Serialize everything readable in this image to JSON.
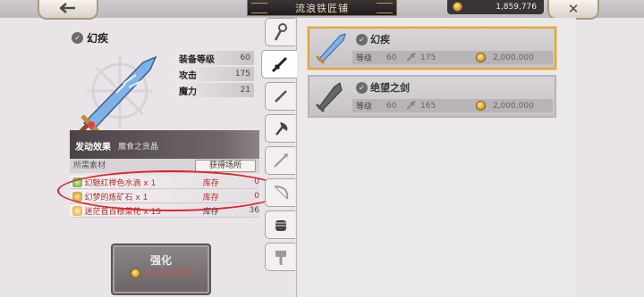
{
  "header": {
    "back_icon": "arrow-left-icon",
    "back_glyph": "🡐",
    "title": "流浪铁匠铺",
    "gold_amount": "1,859,776",
    "close_glyph": "✕"
  },
  "item": {
    "name": "幻疾",
    "stats": [
      {
        "label": "装备等级",
        "value": "60"
      },
      {
        "label": "攻击",
        "value": "175"
      },
      {
        "label": "魔力",
        "value": "21"
      }
    ],
    "effect_label": "发动效果",
    "effect_value": "魔食之贪晶"
  },
  "materials": {
    "header": "所需素材",
    "source_button": "获得场所",
    "rows": [
      {
        "name": "幻魅红榉色水滴 x 1",
        "stock_label": "库存",
        "count": "0"
      },
      {
        "name": "幻梦的炼矿石 x 1",
        "stock_label": "库存",
        "count": "0"
      },
      {
        "name": "迷茫首百穆菜花 x 15",
        "stock_label": "库存",
        "count": "36"
      }
    ]
  },
  "enhance": {
    "label": "强化",
    "cost": "2,000,000"
  },
  "tabs": [
    "staff-tab",
    "sword-tab",
    "dagger-tab",
    "axe-tab",
    "spear-tab",
    "bow-tab",
    "gauntlet-tab",
    "hammer-tab"
  ],
  "weapon_list": [
    {
      "name": "幻疾",
      "level_label": "等级",
      "level": "60",
      "attack": "175",
      "cost": "2,000,000",
      "selected": true
    },
    {
      "name": "绝望之剑",
      "level_label": "等级",
      "level": "60",
      "attack": "165",
      "cost": "2,000,000",
      "selected": false
    }
  ],
  "colors": {
    "accent_gold": "#d9a640",
    "missing_red": "#b0302a",
    "annotation_red": "#e0222a"
  }
}
